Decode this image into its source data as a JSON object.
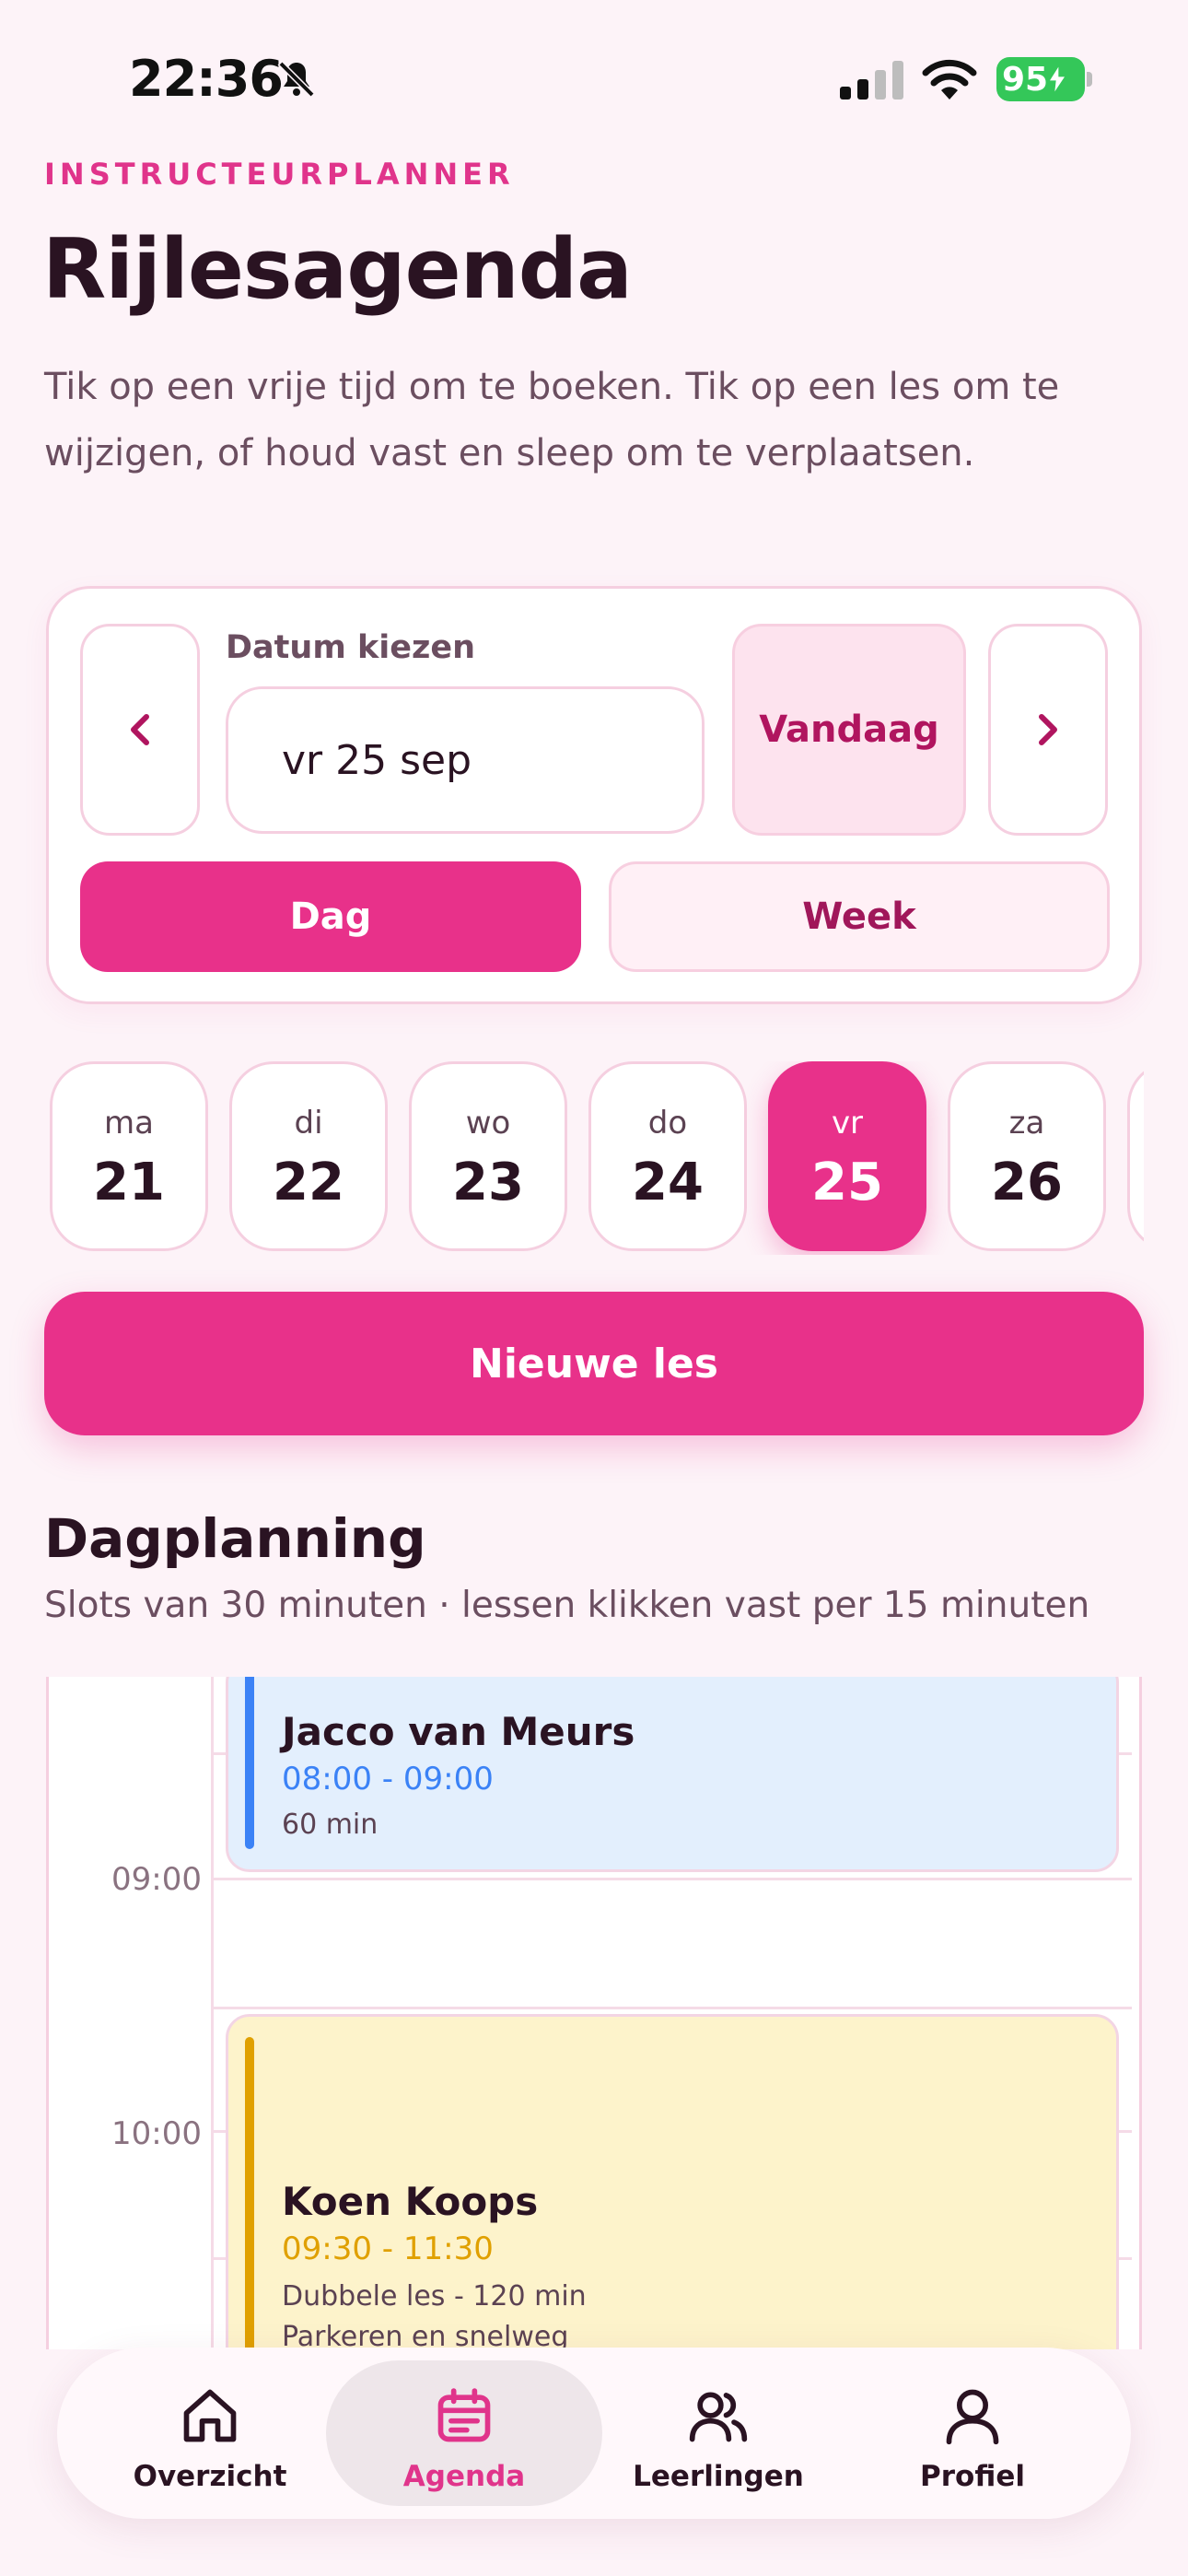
{
  "status_bar": {
    "time": "22:36",
    "battery": "95"
  },
  "header": {
    "overline": "INSTRUCTEURPLANNER",
    "title": "Rijlesagenda",
    "description": "Tik op een vrije tijd om te boeken. Tik op een les om te wijzigen, of houd vast en sleep om te verplaatsen."
  },
  "date_picker": {
    "label": "Datum kiezen",
    "value": "vr 25 sep",
    "today_label": "Vandaag",
    "view_day": "Dag",
    "view_week": "Week"
  },
  "days": [
    {
      "name": "ma",
      "num": "21"
    },
    {
      "name": "di",
      "num": "22"
    },
    {
      "name": "wo",
      "num": "23"
    },
    {
      "name": "do",
      "num": "24"
    },
    {
      "name": "vr",
      "num": "25"
    },
    {
      "name": "za",
      "num": "26"
    }
  ],
  "new_lesson_label": "Nieuwe les",
  "planning": {
    "title": "Dagplanning",
    "subtitle": "Slots van 30 minuten · lessen klikken vast per 15 minuten",
    "time_labels": [
      "09:00",
      "10:00"
    ],
    "lessons": [
      {
        "student": "Jacco van Meurs",
        "time": "08:00 - 09:00",
        "duration": "60 min",
        "note": ""
      },
      {
        "student": "Koen Koops",
        "time": "09:30 - 11:30",
        "duration": "Dubbele les - 120 min",
        "note": "Parkeren en snelweg"
      }
    ]
  },
  "tabs": [
    {
      "label": "Overzicht",
      "icon": "home-icon"
    },
    {
      "label": "Agenda",
      "icon": "calendar-icon"
    },
    {
      "label": "Leerlingen",
      "icon": "users-icon"
    },
    {
      "label": "Profiel",
      "icon": "profile-icon"
    }
  ],
  "colors": {
    "accent": "#e8318a",
    "lesson_blue": "#3b82f6",
    "lesson_yellow": "#e0a000"
  }
}
